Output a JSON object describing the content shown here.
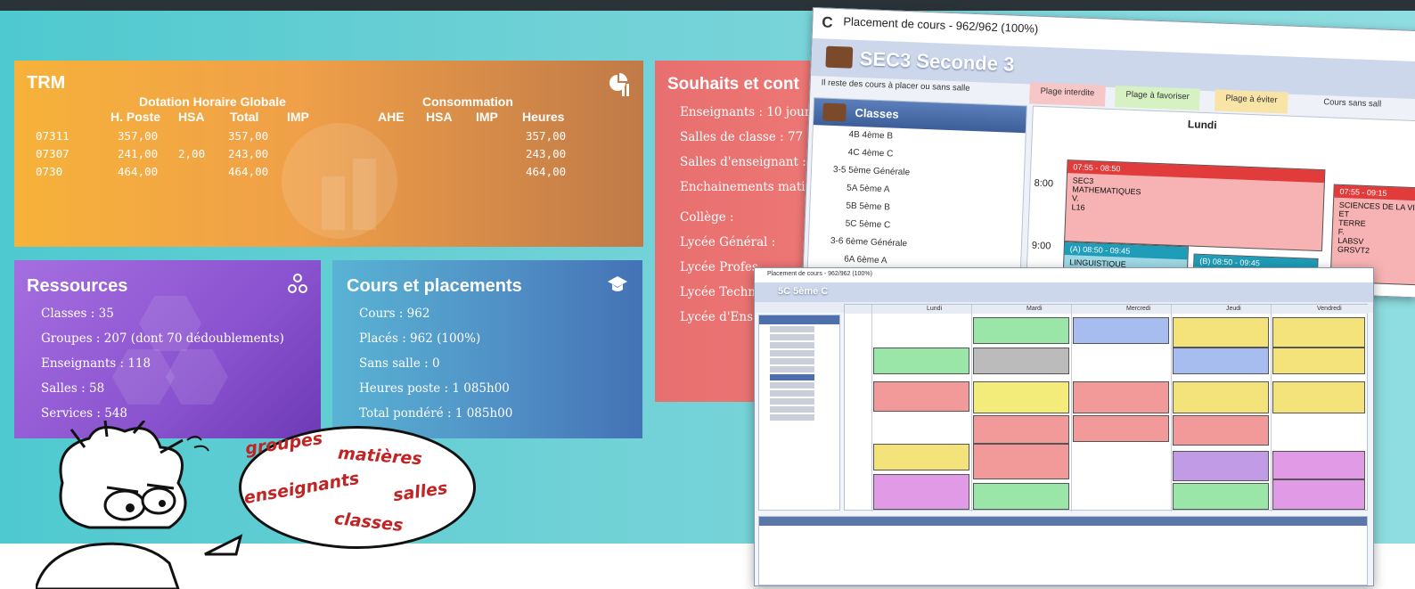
{
  "trm": {
    "title": "TRM",
    "group_dotation": "Dotation Horaire Globale",
    "group_consommation": "Consommation",
    "columns": [
      "H. Poste",
      "HSA",
      "Total",
      "IMP",
      "AHE",
      "HSA",
      "IMP",
      "Heures"
    ],
    "rows": [
      {
        "code": "07311",
        "h_poste": "357,00",
        "hsa": "",
        "total": "357,00",
        "heures": "357,00"
      },
      {
        "code": "07307",
        "h_poste": "241,00",
        "hsa": "2,00",
        "total": "243,00",
        "heures": "243,00"
      },
      {
        "code": "0730",
        "h_poste": "464,00",
        "hsa": "",
        "total": "464,00",
        "heures": "464,00"
      }
    ]
  },
  "souhaits": {
    "title": "Souhaits et cont",
    "lines": [
      "Enseignants : 10 jour",
      "Salles de classe : 77",
      "Salles d'enseignant :",
      "Enchainements mati",
      "Collège :",
      "Lycée Général :",
      "Lycée Profes",
      "Lycée Techn",
      "Lycée d'Ens"
    ]
  },
  "ressources": {
    "title": "Ressources",
    "lines": [
      "Classes : 35",
      "Groupes : 207 (dont 70 dédoublements)",
      "Enseignants : 118",
      "Salles : 58",
      "Services : 548"
    ]
  },
  "cours": {
    "title": "Cours et placements",
    "lines": [
      "Cours : 962",
      "Placés : 962 (100%)",
      "Sans salle : 0",
      "Heures poste : 1 085h00",
      "Total pondéré : 1 085h00"
    ]
  },
  "bubble": {
    "words": [
      "groupes",
      "matières",
      "enseignants",
      "salles",
      "classes"
    ]
  },
  "win1": {
    "title": "Placement de cours - 962/962 (100%)",
    "logo": "C",
    "header": "SEC3  Seconde 3",
    "brief": "Il reste des cours à placer ou sans salle",
    "tabs": [
      "Plage interdite",
      "Plage à favoriser",
      "Plage à éviter",
      "Cours sans sall"
    ],
    "tree_title": "Classes",
    "tree_rows": [
      "4B 4ème B",
      "4C 4ème C",
      "3-5 5ème Générale",
      "5A 5ème A",
      "5B 5ème B",
      "5C 5ème C",
      "3-6 6ème Générale",
      "6A 6ème A"
    ],
    "day": "Lundi",
    "times": [
      "8:00",
      "9:00"
    ],
    "slots": [
      {
        "time": "07:55 - 08:50",
        "line1": "SEC3",
        "line2": "MATHEMATIQUES",
        "line3": "V.",
        "line4": "L16"
      },
      {
        "time": "07:55 - 09:15",
        "line1": "SCIENCES DE LA VIE ET",
        "line2": "TERRE",
        "line3": "F.",
        "line4": "LABSV",
        "line5": "GRSVT2"
      },
      {
        "time": "(A) 08:50 - 09:45",
        "line1": "LINGUISTIQUE"
      },
      {
        "time": "(B) 08:50 - 09:45"
      }
    ]
  },
  "win2": {
    "title": "Placement de cours - 962/962 (100%)",
    "header": "5C 5ème C",
    "days": [
      "Lundi",
      "Mardi",
      "Mercredi",
      "Jeudi",
      "Vendredi"
    ]
  }
}
